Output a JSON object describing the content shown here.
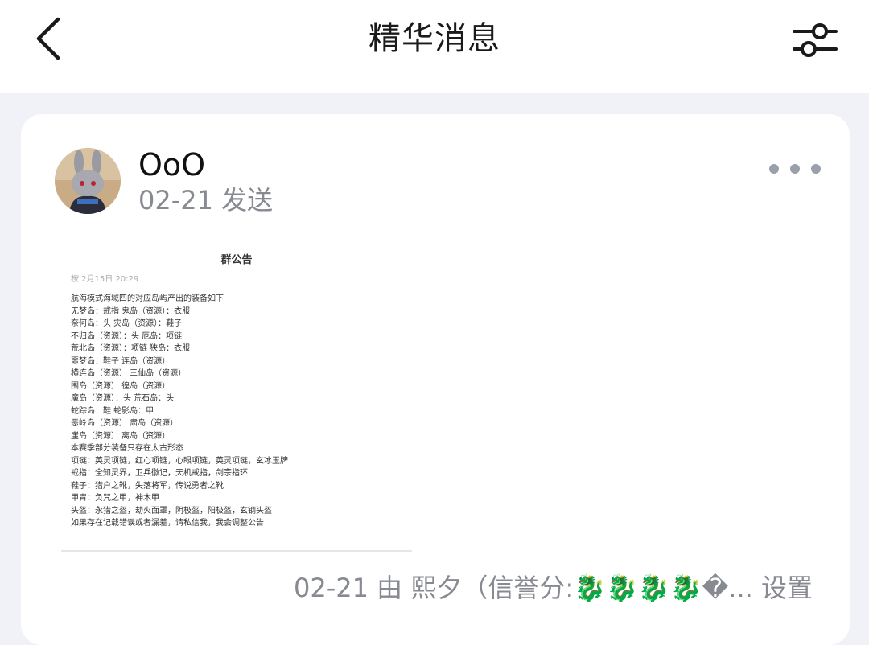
{
  "header": {
    "title": "精华消息"
  },
  "message": {
    "author": "OoO",
    "time": "02-21 发送",
    "announcement": {
      "title": "群公告",
      "meta": "桉 2月15日 20:29",
      "lines": [
        "航海模式海域四的对应岛屿产出的装备如下",
        "无梦岛：戒指 鬼岛（资源）：衣服",
        "奈何岛：头 灾岛（资源）：鞋子",
        "不归岛（资源）：头 厄岛：项链",
        "荒北岛（资源）：项链 狭岛：衣服",
        "噩梦岛：鞋子 连岛（资源）",
        "横连岛（资源） 三仙岛（资源）",
        "围岛（资源） 徨岛（资源）",
        "魔岛（资源）：头 荒石岛：头",
        "蛇踪岛：鞋 蛇影岛：甲",
        "恶岭岛（资源） 肃岛（资源）",
        "崖岛（资源） 离岛（资源）",
        "本赛季部分装备只存在太古形态",
        "项链：英灵项链，红心项链，心眼项链，英灵项链，玄冰玉牌",
        "戒指：全知灵界，卫兵徽记，天机戒指，剑宗指环",
        "鞋子：猎户之靴，失落将军，传说勇者之靴",
        "甲胄：负咒之甲，神木甲",
        "头盔：永猎之盔，劫火面罩，阴极盔，阳极盔，玄钢头盔",
        "如果存在记载错误或者漏差，请私信我，我会调整公告"
      ]
    },
    "footer": {
      "text": "02-21 由 熙夕（信誉分:🐉🐉🐉🐉�...",
      "action": "设置"
    }
  },
  "icons": {
    "back": "chevron-left-icon",
    "filter": "sliders-icon",
    "more": "more-dots-icon"
  }
}
